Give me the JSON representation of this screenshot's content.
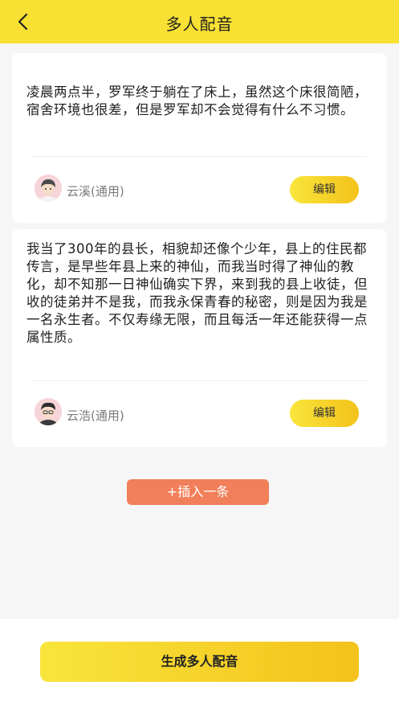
{
  "header": {
    "title": "多人配音",
    "back_icon": "chevron-left-icon",
    "background_color": "#f8e133"
  },
  "segments": [
    {
      "text": "凌晨两点半，罗军终于躺在了床上，虽然这个床很简陋，宿舍环境也很差，但是罗军却不会觉得有什么不习惯。",
      "voice_name": "云溪(通用)",
      "edit_label": "编辑"
    },
    {
      "text": "我当了300年的县长，相貌却还像个少年，县上的住民都传言，是早些年县上来的神仙，而我当时得了神仙的教化，却不知那一日神仙确实下界，来到我的县上收徒，但收的徒弟并不是我，而我永保青春的秘密，则是因为我是一名永生者。不仅寿缘无限，而且每活一年还能获得一点属性质。",
      "voice_name": "云浩(通用)",
      "edit_label": "编辑"
    }
  ],
  "insert_button": {
    "label": "+插入一条",
    "color": "#f07f5a"
  },
  "generate_button": {
    "label": "生成多人配音"
  }
}
